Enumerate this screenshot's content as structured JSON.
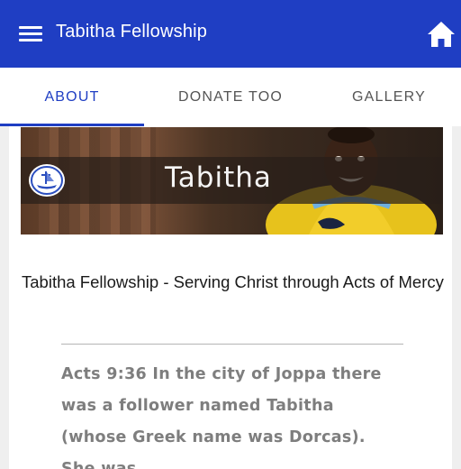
{
  "app_bar": {
    "title": "Tabitha Fellowship",
    "icons": [
      "menu-icon",
      "home-icon"
    ],
    "color": "#1f3ec3"
  },
  "tabs": [
    {
      "label": "ABOUT",
      "active": true
    },
    {
      "label": "DONATE TOO",
      "active": false
    },
    {
      "label": "GALLERY",
      "active": false
    }
  ],
  "banner": {
    "title": "Tabitha"
  },
  "content": {
    "headline": "Tabitha Fellowship - Serving Christ through Acts of Mercy",
    "scripture": "Acts 9:36 In the city of Joppa there was a follower named Tabitha (whose Greek name was Dorcas). She was"
  }
}
